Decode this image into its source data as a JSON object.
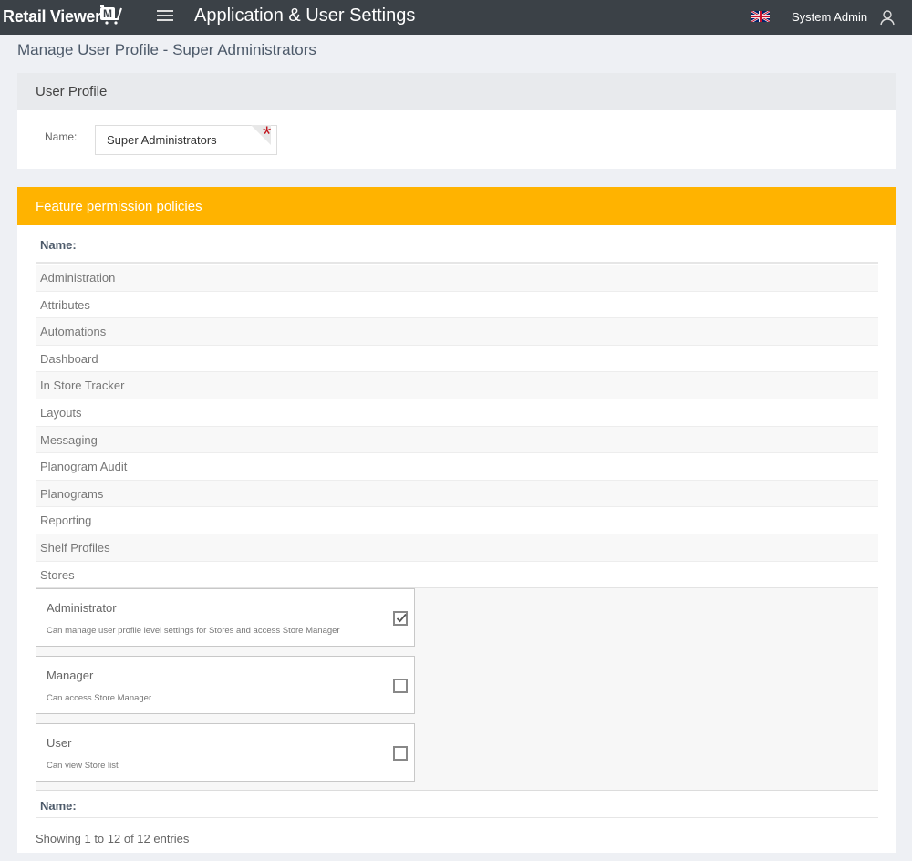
{
  "topbar": {
    "brand": "Retail Viewer",
    "brand_badge": "M",
    "app_title": "Application & User Settings",
    "language_icon": "uk-flag-icon",
    "user_name": "System Admin"
  },
  "page": {
    "title": "Manage User Profile - Super Administrators"
  },
  "profile": {
    "heading": "User Profile",
    "name_label": "Name:",
    "name_value": "Super Administrators",
    "required_marker": "*"
  },
  "features": {
    "heading": "Feature permission policies",
    "column_header": "Name:",
    "rows": [
      "Administration",
      "Attributes",
      "Automations",
      "Dashboard",
      "In Store Tracker",
      "Layouts",
      "Messaging",
      "Planogram Audit",
      "Planograms",
      "Reporting",
      "Shelf Profiles",
      "Stores"
    ],
    "policies": [
      {
        "title": "Administrator",
        "description": "Can manage user profile level settings for Stores and access Store Manager",
        "checked": true
      },
      {
        "title": "Manager",
        "description": "Can access Store Manager",
        "checked": false
      },
      {
        "title": "User",
        "description": "Can view Store list",
        "checked": false
      }
    ],
    "footer_header": "Name:",
    "entries_info": "Showing 1 to 12 of 12 entries"
  },
  "colors": {
    "topbar": "#3b4147",
    "accent": "#ffb300",
    "required": "#c1151d"
  }
}
